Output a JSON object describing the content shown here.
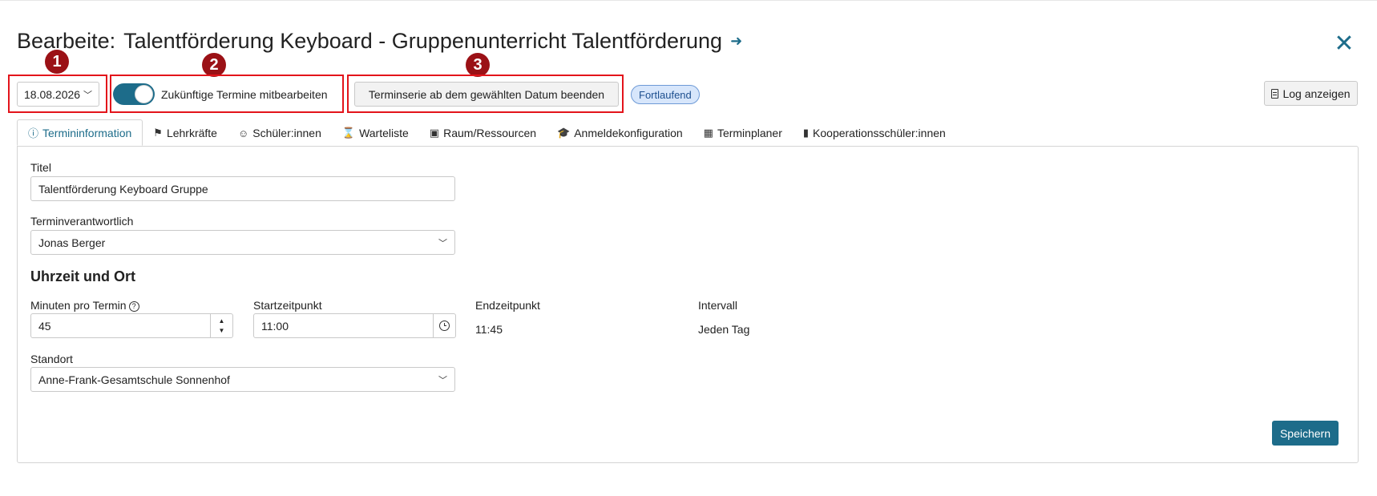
{
  "header": {
    "title_prefix": "Bearbeite:",
    "title": "Talentförderung Keyboard - Gruppenunterricht Talentförderung",
    "close_symbol": "✕"
  },
  "markers": [
    "1",
    "2",
    "3"
  ],
  "toolbar": {
    "date_value": "18.08.2026",
    "toggle_label": "Zukünftige Termine mitbearbeiten",
    "toggle_on": true,
    "end_series_label": "Terminserie ab dem gewählten Datum beenden",
    "status_badge": "Fortlaufend",
    "log_label": "Log anzeigen"
  },
  "tabs": [
    {
      "label": "Termininformation",
      "icon": "info-circle-icon",
      "glyph": "ⓘ",
      "active": true
    },
    {
      "label": "Lehrkräfte",
      "icon": "teacher-icon",
      "glyph": "⚑",
      "active": false
    },
    {
      "label": "Schüler:innen",
      "icon": "students-icon",
      "glyph": "☺",
      "active": false
    },
    {
      "label": "Warteliste",
      "icon": "hourglass-icon",
      "glyph": "⌛",
      "active": false
    },
    {
      "label": "Raum/Ressourcen",
      "icon": "briefcase-icon",
      "glyph": "▣",
      "active": false
    },
    {
      "label": "Anmeldekonfiguration",
      "icon": "graduation-cap-icon",
      "glyph": "🎓",
      "active": false
    },
    {
      "label": "Terminplaner",
      "icon": "calendar-icon",
      "glyph": "▦",
      "active": false
    },
    {
      "label": "Kooperationsschüler:innen",
      "icon": "bar-chart-icon",
      "glyph": "▮",
      "active": false
    }
  ],
  "form": {
    "titel_label": "Titel",
    "titel_value": "Talentförderung Keyboard Gruppe",
    "responsible_label": "Terminverantwortlich",
    "responsible_value": "Jonas Berger",
    "section_time_place": "Uhrzeit und Ort",
    "minutes_label": "Minuten pro Termin",
    "minutes_value": "45",
    "start_label": "Startzeitpunkt",
    "start_value": "11:00",
    "end_label": "Endzeitpunkt",
    "end_value": "11:45",
    "interval_label": "Intervall",
    "interval_value": "Jeden Tag",
    "location_label": "Standort",
    "location_value": "Anne-Frank-Gesamtschule Sonnenhof",
    "save_label": "Speichern"
  },
  "colors": {
    "accent": "#1d6c8a",
    "marker": "#9b1116",
    "highlight_box": "#e3141b",
    "badge_bg": "#d7e6fb"
  }
}
